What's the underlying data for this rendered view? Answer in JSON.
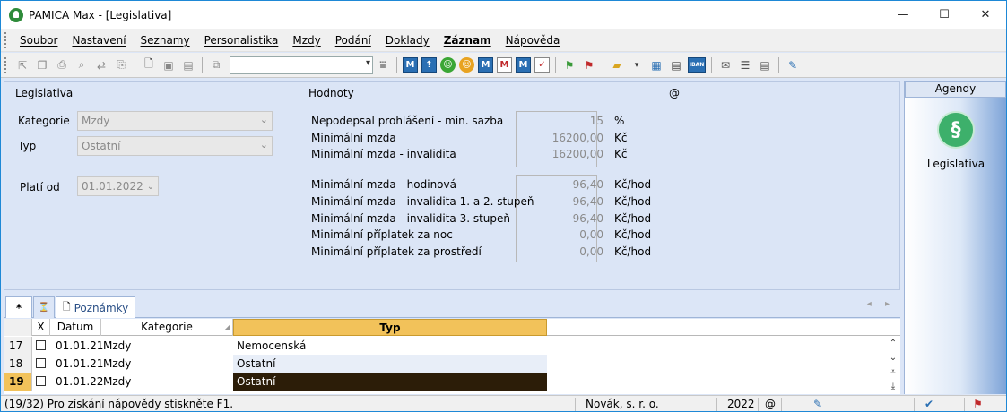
{
  "window": {
    "title": "PAMICA Max - [Legislativa]",
    "controls": {
      "minimize": "—",
      "maximize": "☐",
      "close": "✕"
    }
  },
  "menu": [
    {
      "label": "Soubor",
      "bold": false
    },
    {
      "label": "Nastavení",
      "bold": false
    },
    {
      "label": "Seznamy",
      "bold": false
    },
    {
      "label": "Personalistika",
      "bold": false
    },
    {
      "label": "Mzdy",
      "bold": false
    },
    {
      "label": "Podání",
      "bold": false
    },
    {
      "label": "Doklady",
      "bold": false
    },
    {
      "label": "Záznam",
      "bold": true
    },
    {
      "label": "Nápověda",
      "bold": false
    }
  ],
  "toolbar": {
    "combo_value": "",
    "m_icons": [
      "M",
      "M",
      "M",
      "M"
    ],
    "iban_label": "IBAN"
  },
  "legislativa": {
    "section_title": "Legislativa",
    "kategorie_label": "Kategorie",
    "kategorie_value": "Mzdy",
    "typ_label": "Typ",
    "typ_value": "Ostatní",
    "plati_od_label": "Platí od",
    "plati_od_value": "01.01.2022"
  },
  "hodnoty": {
    "section_title": "Hodnoty",
    "at_symbol": "@",
    "group1": [
      {
        "label": "Nepodepsal prohlášení - min. sazba",
        "value": "15",
        "unit": "%"
      },
      {
        "label": "Minimální mzda",
        "value": "16200,00",
        "unit": "Kč"
      },
      {
        "label": "Minimální mzda - invalidita",
        "value": "16200,00",
        "unit": "Kč"
      }
    ],
    "group2": [
      {
        "label": "Minimální mzda - hodinová",
        "value": "96,40",
        "unit": "Kč/hod"
      },
      {
        "label": "Minimální mzda - invalidita 1. a 2. stupeň",
        "value": "96,40",
        "unit": "Kč/hod"
      },
      {
        "label": "Minimální mzda - invalidita 3. stupeň",
        "value": "96,40",
        "unit": "Kč/hod"
      },
      {
        "label": "Minimální příplatek za noc",
        "value": "0,00",
        "unit": "Kč/hod"
      },
      {
        "label": "Minimální příplatek za prostředí",
        "value": "0,00",
        "unit": "Kč/hod"
      }
    ]
  },
  "agendy": {
    "header": "Agendy",
    "icon_glyph": "§",
    "item_label": "Legislativa"
  },
  "tabs": {
    "star": "*",
    "filter_icon": "⏳",
    "notes_icon": "🗋",
    "notes_label": "Poznámky",
    "nav": "◂ ▸"
  },
  "grid": {
    "headers": {
      "x": "X",
      "datum": "Datum",
      "kategorie": "Kategorie",
      "typ": "Typ"
    },
    "rows": [
      {
        "num": "17",
        "datum": "01.01.21",
        "kategorie": "Mzdy",
        "typ": "Nemocenská",
        "selected": false
      },
      {
        "num": "18",
        "datum": "01.01.21",
        "kategorie": "Mzdy",
        "typ": "Ostatní",
        "selected": false
      },
      {
        "num": "19",
        "datum": "01.01.22",
        "kategorie": "Mzdy",
        "typ": "Ostatní",
        "selected": true
      }
    ]
  },
  "status": {
    "help_text": "(19/32) Pro získání nápovědy stiskněte F1.",
    "company": "Novák, s. r. o.",
    "year": "2022",
    "at": "@"
  }
}
